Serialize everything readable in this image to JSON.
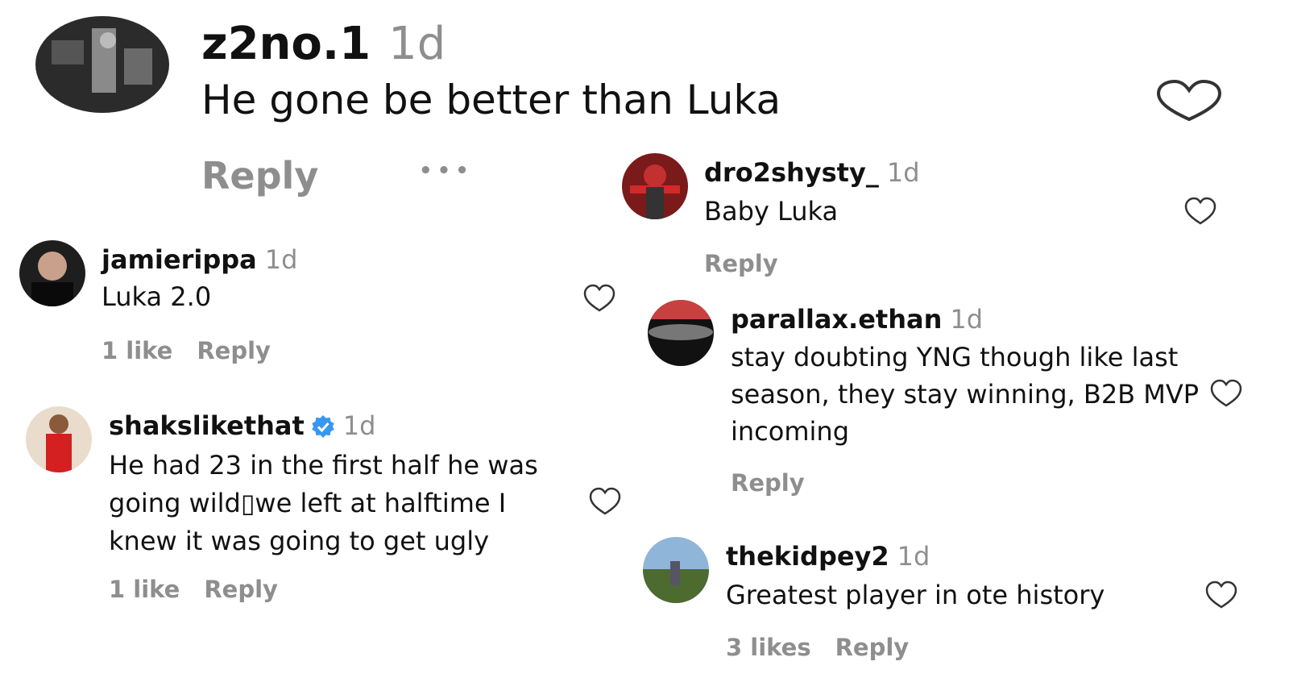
{
  "main_comment": {
    "username": "z2no.1",
    "time": "1d",
    "text": "He gone be better than Luka",
    "reply": "Reply",
    "more": "•••"
  },
  "left_comments": [
    {
      "username": "jamierippa",
      "time": "1d",
      "text": [
        "Luka 2.0"
      ],
      "likes": "1 like",
      "reply": "Reply"
    },
    {
      "username": "shakslikethat",
      "verified": true,
      "time": "1d",
      "text": [
        "He had 23 in the first half he was",
        "going wild▯we left at halftime I",
        "knew it was going to get ugly"
      ],
      "likes": "1 like",
      "reply": "Reply"
    }
  ],
  "right_comments": [
    {
      "username": "dro2shysty_",
      "time": "1d",
      "text": [
        "Baby Luka"
      ],
      "reply": "Reply"
    },
    {
      "username": "parallax.ethan",
      "time": "1d",
      "text": [
        "stay doubting YNG though like last",
        "season, they stay winning, B2B MVP",
        "incoming"
      ],
      "reply": "Reply"
    },
    {
      "username": "thekidpey2",
      "time": "1d",
      "text": [
        "Greatest player in ote history"
      ],
      "likes": "3 likes",
      "reply": "Reply"
    }
  ],
  "icons": {
    "like": "heart-outline-icon",
    "verified": "verified-badge-icon",
    "more": "more-options-icon"
  },
  "colors": {
    "text": "#111111",
    "muted": "#8e8e8e",
    "verified": "#3897f0"
  }
}
